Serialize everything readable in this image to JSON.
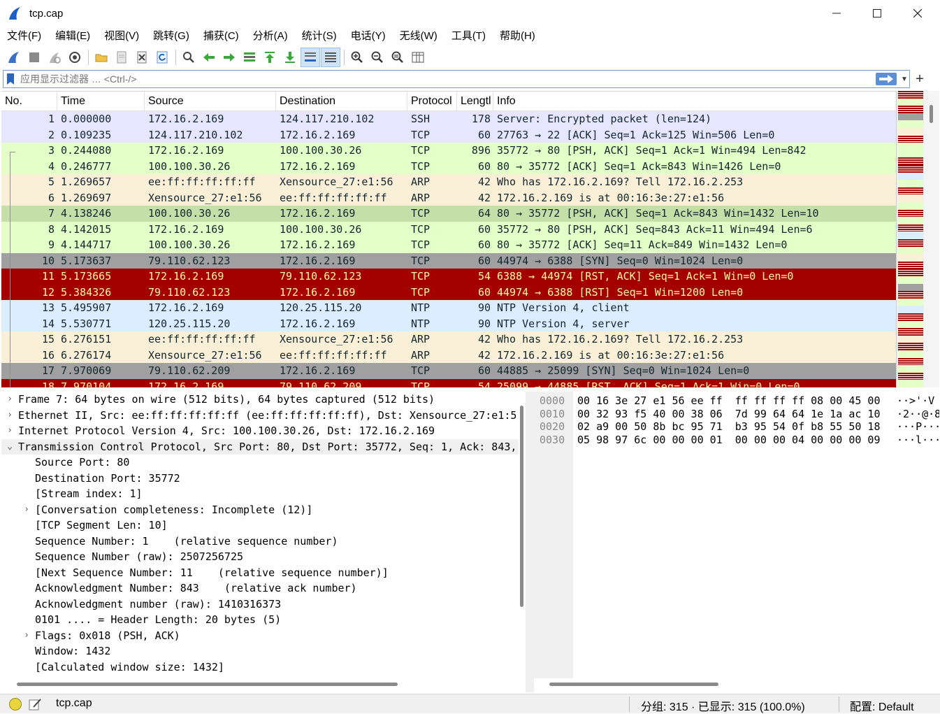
{
  "window": {
    "title": "tcp.cap",
    "min_icon": "minimize-icon",
    "max_icon": "maximize-icon",
    "close_icon": "close-icon"
  },
  "menu": [
    "文件(F)",
    "编辑(E)",
    "视图(V)",
    "跳转(G)",
    "捕获(C)",
    "分析(A)",
    "统计(S)",
    "电话(Y)",
    "无线(W)",
    "工具(T)",
    "帮助(H)"
  ],
  "toolbar": {
    "icons": [
      "start-capture-icon",
      "stop-capture-icon",
      "restart-capture-icon",
      "capture-options-icon",
      "open-file-icon",
      "save-file-icon",
      "close-file-icon",
      "reload-icon",
      "find-packet-icon",
      "go-back-icon",
      "go-forward-icon",
      "go-to-packet-icon",
      "first-packet-icon",
      "last-packet-icon",
      "auto-scroll-icon",
      "colorize-icon",
      "zoom-in-icon",
      "zoom-out-icon",
      "normal-size-icon",
      "resize-columns-icon"
    ]
  },
  "filter": {
    "placeholder": "应用显示过滤器 … <Ctrl-/>",
    "value": ""
  },
  "packet_list": {
    "columns": [
      "No.",
      "Time",
      "Source",
      "Destination",
      "Protocol",
      "Lengtl",
      "Info"
    ],
    "rows": [
      {
        "no": "1",
        "time": "0.000000",
        "src": "172.16.2.169",
        "dst": "124.117.210.102",
        "proto": "SSH",
        "len": "178",
        "info": "Server: Encrypted packet (len=124)",
        "bg": "#e7e6ff",
        "fg": "#12272e"
      },
      {
        "no": "2",
        "time": "0.109235",
        "src": "124.117.210.102",
        "dst": "172.16.2.169",
        "proto": "TCP",
        "len": "60",
        "info": "27763 → 22 [ACK] Seq=1 Ack=125 Win=506 Len=0",
        "bg": "#e7e6ff",
        "fg": "#12272e"
      },
      {
        "no": "3",
        "time": "0.244080",
        "src": "172.16.2.169",
        "dst": "100.100.30.26",
        "proto": "TCP",
        "len": "896",
        "info": "35772 → 80 [PSH, ACK] Seq=1 Ack=1 Win=494 Len=842",
        "bg": "#e4ffc7",
        "fg": "#12272e"
      },
      {
        "no": "4",
        "time": "0.246777",
        "src": "100.100.30.26",
        "dst": "172.16.2.169",
        "proto": "TCP",
        "len": "60",
        "info": "80 → 35772 [ACK] Seq=1 Ack=843 Win=1426 Len=0",
        "bg": "#e4ffc7",
        "fg": "#12272e"
      },
      {
        "no": "5",
        "time": "1.269657",
        "src": "ee:ff:ff:ff:ff:ff",
        "dst": "Xensource_27:e1:56",
        "proto": "ARP",
        "len": "42",
        "info": "Who has 172.16.2.169? Tell 172.16.2.253",
        "bg": "#faf0d7",
        "fg": "#12272e"
      },
      {
        "no": "6",
        "time": "1.269697",
        "src": "Xensource_27:e1:56",
        "dst": "ee:ff:ff:ff:ff:ff",
        "proto": "ARP",
        "len": "42",
        "info": "172.16.2.169 is at 00:16:3e:27:e1:56",
        "bg": "#faf0d7",
        "fg": "#12272e"
      },
      {
        "no": "7",
        "time": "4.138246",
        "src": "100.100.30.26",
        "dst": "172.16.2.169",
        "proto": "TCP",
        "len": "64",
        "info": "80 → 35772 [PSH, ACK] Seq=1 Ack=843 Win=1432 Len=10",
        "bg": "#c6dfa8",
        "fg": "#12272e"
      },
      {
        "no": "8",
        "time": "4.142015",
        "src": "172.16.2.169",
        "dst": "100.100.30.26",
        "proto": "TCP",
        "len": "60",
        "info": "35772 → 80 [PSH, ACK] Seq=843 Ack=11 Win=494 Len=6",
        "bg": "#e4ffc7",
        "fg": "#12272e"
      },
      {
        "no": "9",
        "time": "4.144717",
        "src": "100.100.30.26",
        "dst": "172.16.2.169",
        "proto": "TCP",
        "len": "60",
        "info": "80 → 35772 [ACK] Seq=11 Ack=849 Win=1432 Len=0",
        "bg": "#e4ffc7",
        "fg": "#12272e"
      },
      {
        "no": "10",
        "time": "5.173637",
        "src": "79.110.62.123",
        "dst": "172.16.2.169",
        "proto": "TCP",
        "len": "60",
        "info": "44974 → 6388 [SYN] Seq=0 Win=1024 Len=0",
        "bg": "#a0a0a0",
        "fg": "#12272e"
      },
      {
        "no": "11",
        "time": "5.173665",
        "src": "172.16.2.169",
        "dst": "79.110.62.123",
        "proto": "TCP",
        "len": "54",
        "info": "6388 → 44974 [RST, ACK] Seq=1 Ack=1 Win=0 Len=0",
        "bg": "#a40000",
        "fg": "#fffc9c"
      },
      {
        "no": "12",
        "time": "5.384326",
        "src": "79.110.62.123",
        "dst": "172.16.2.169",
        "proto": "TCP",
        "len": "60",
        "info": "44974 → 6388 [RST] Seq=1 Win=1200 Len=0",
        "bg": "#a40000",
        "fg": "#fffc9c"
      },
      {
        "no": "13",
        "time": "5.495907",
        "src": "172.16.2.169",
        "dst": "120.25.115.20",
        "proto": "NTP",
        "len": "90",
        "info": "NTP Version 4, client",
        "bg": "#daeeff",
        "fg": "#12272e"
      },
      {
        "no": "14",
        "time": "5.530771",
        "src": "120.25.115.20",
        "dst": "172.16.2.169",
        "proto": "NTP",
        "len": "90",
        "info": "NTP Version 4, server",
        "bg": "#daeeff",
        "fg": "#12272e"
      },
      {
        "no": "15",
        "time": "6.276151",
        "src": "ee:ff:ff:ff:ff:ff",
        "dst": "Xensource_27:e1:56",
        "proto": "ARP",
        "len": "42",
        "info": "Who has 172.16.2.169? Tell 172.16.2.253",
        "bg": "#faf0d7",
        "fg": "#12272e"
      },
      {
        "no": "16",
        "time": "6.276174",
        "src": "Xensource_27:e1:56",
        "dst": "ee:ff:ff:ff:ff:ff",
        "proto": "ARP",
        "len": "42",
        "info": "172.16.2.169 is at 00:16:3e:27:e1:56",
        "bg": "#faf0d7",
        "fg": "#12272e"
      },
      {
        "no": "17",
        "time": "7.970069",
        "src": "79.110.62.209",
        "dst": "172.16.2.169",
        "proto": "TCP",
        "len": "60",
        "info": "44885 → 25099 [SYN] Seq=0 Win=1024 Len=0",
        "bg": "#a0a0a0",
        "fg": "#12272e"
      },
      {
        "no": "18",
        "time": "7.970104",
        "src": "172.16.2.169",
        "dst": "79.110.62.209",
        "proto": "TCP",
        "len": "54",
        "info": "25099 → 44885 [RST, ACK] Seq=1 Ack=1 Win=0 Len=0",
        "bg": "#a40000",
        "fg": "#fffc9c"
      }
    ]
  },
  "details": [
    {
      "text": "Frame 7: 64 bytes on wire (512 bits), 64 bytes captured (512 bits)",
      "level": 0,
      "arrow": "›"
    },
    {
      "text": "Ethernet II, Src: ee:ff:ff:ff:ff:ff (ee:ff:ff:ff:ff:ff), Dst: Xensource_27:e1:5",
      "level": 0,
      "arrow": "›"
    },
    {
      "text": "Internet Protocol Version 4, Src: 100.100.30.26, Dst: 172.16.2.169",
      "level": 0,
      "arrow": "›"
    },
    {
      "text": "Transmission Control Protocol, Src Port: 80, Dst Port: 35772, Seq: 1, Ack: 843,",
      "level": 0,
      "arrow": "⌄"
    },
    {
      "text": "Source Port: 80",
      "level": 1,
      "arrow": ""
    },
    {
      "text": "Destination Port: 35772",
      "level": 1,
      "arrow": ""
    },
    {
      "text": "[Stream index: 1]",
      "level": 1,
      "arrow": ""
    },
    {
      "text": "[Conversation completeness: Incomplete (12)]",
      "level": 1,
      "arrow": "›"
    },
    {
      "text": "[TCP Segment Len: 10]",
      "level": 1,
      "arrow": ""
    },
    {
      "text": "Sequence Number: 1    (relative sequence number)",
      "level": 1,
      "arrow": ""
    },
    {
      "text": "Sequence Number (raw): 2507256725",
      "level": 1,
      "arrow": ""
    },
    {
      "text": "[Next Sequence Number: 11    (relative sequence number)]",
      "level": 1,
      "arrow": ""
    },
    {
      "text": "Acknowledgment Number: 843    (relative ack number)",
      "level": 1,
      "arrow": ""
    },
    {
      "text": "Acknowledgment number (raw): 1410316373",
      "level": 1,
      "arrow": ""
    },
    {
      "text": "0101 .... = Header Length: 20 bytes (5)",
      "level": 1,
      "arrow": ""
    },
    {
      "text": "Flags: 0x018 (PSH, ACK)",
      "level": 1,
      "arrow": "›"
    },
    {
      "text": "Window: 1432",
      "level": 1,
      "arrow": ""
    },
    {
      "text": "[Calculated window size: 1432]",
      "level": 1,
      "arrow": ""
    }
  ],
  "bytes": [
    {
      "offset": "0000",
      "hex": "00 16 3e 27 e1 56 ee ff  ff ff ff ff 08 00 45 00",
      "ascii": "··>'·V"
    },
    {
      "offset": "0010",
      "hex": "00 32 93 f5 40 00 38 06  7d 99 64 64 1e 1a ac 10",
      "ascii": "·2··@·8"
    },
    {
      "offset": "0020",
      "hex": "02 a9 00 50 8b bc 95 71  b3 95 54 0f b8 55 50 18",
      "ascii": "···P···"
    },
    {
      "offset": "0030",
      "hex": "05 98 97 6c 00 00 00 01  00 00 00 04 00 00 00 09",
      "ascii": "···l····"
    }
  ],
  "status": {
    "file": "tcp.cap",
    "packets": "分组: 315 · 已显示: 315 (100.0%)",
    "profile": "配置:  Default"
  },
  "minimap_colors": {
    "red": "#a40000",
    "green": "#e4ffc7",
    "gray": "#a0a0a0",
    "blue": "#daeeff",
    "beige": "#faf0d7"
  }
}
